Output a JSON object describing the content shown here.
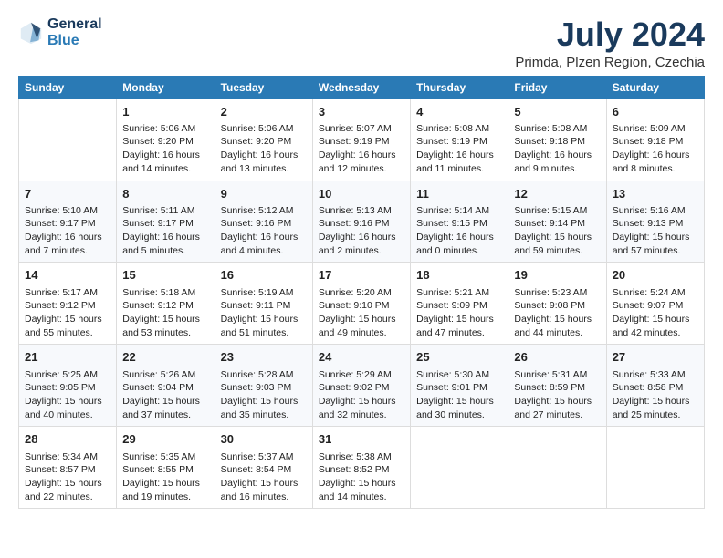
{
  "header": {
    "logo_line1": "General",
    "logo_line2": "Blue",
    "title": "July 2024",
    "subtitle": "Primda, Plzen Region, Czechia"
  },
  "columns": [
    "Sunday",
    "Monday",
    "Tuesday",
    "Wednesday",
    "Thursday",
    "Friday",
    "Saturday"
  ],
  "weeks": [
    {
      "cells": [
        {
          "day": "",
          "lines": []
        },
        {
          "day": "1",
          "lines": [
            "Sunrise: 5:06 AM",
            "Sunset: 9:20 PM",
            "Daylight: 16 hours",
            "and 14 minutes."
          ]
        },
        {
          "day": "2",
          "lines": [
            "Sunrise: 5:06 AM",
            "Sunset: 9:20 PM",
            "Daylight: 16 hours",
            "and 13 minutes."
          ]
        },
        {
          "day": "3",
          "lines": [
            "Sunrise: 5:07 AM",
            "Sunset: 9:19 PM",
            "Daylight: 16 hours",
            "and 12 minutes."
          ]
        },
        {
          "day": "4",
          "lines": [
            "Sunrise: 5:08 AM",
            "Sunset: 9:19 PM",
            "Daylight: 16 hours",
            "and 11 minutes."
          ]
        },
        {
          "day": "5",
          "lines": [
            "Sunrise: 5:08 AM",
            "Sunset: 9:18 PM",
            "Daylight: 16 hours",
            "and 9 minutes."
          ]
        },
        {
          "day": "6",
          "lines": [
            "Sunrise: 5:09 AM",
            "Sunset: 9:18 PM",
            "Daylight: 16 hours",
            "and 8 minutes."
          ]
        }
      ]
    },
    {
      "cells": [
        {
          "day": "7",
          "lines": [
            "Sunrise: 5:10 AM",
            "Sunset: 9:17 PM",
            "Daylight: 16 hours",
            "and 7 minutes."
          ]
        },
        {
          "day": "8",
          "lines": [
            "Sunrise: 5:11 AM",
            "Sunset: 9:17 PM",
            "Daylight: 16 hours",
            "and 5 minutes."
          ]
        },
        {
          "day": "9",
          "lines": [
            "Sunrise: 5:12 AM",
            "Sunset: 9:16 PM",
            "Daylight: 16 hours",
            "and 4 minutes."
          ]
        },
        {
          "day": "10",
          "lines": [
            "Sunrise: 5:13 AM",
            "Sunset: 9:16 PM",
            "Daylight: 16 hours",
            "and 2 minutes."
          ]
        },
        {
          "day": "11",
          "lines": [
            "Sunrise: 5:14 AM",
            "Sunset: 9:15 PM",
            "Daylight: 16 hours",
            "and 0 minutes."
          ]
        },
        {
          "day": "12",
          "lines": [
            "Sunrise: 5:15 AM",
            "Sunset: 9:14 PM",
            "Daylight: 15 hours",
            "and 59 minutes."
          ]
        },
        {
          "day": "13",
          "lines": [
            "Sunrise: 5:16 AM",
            "Sunset: 9:13 PM",
            "Daylight: 15 hours",
            "and 57 minutes."
          ]
        }
      ]
    },
    {
      "cells": [
        {
          "day": "14",
          "lines": [
            "Sunrise: 5:17 AM",
            "Sunset: 9:12 PM",
            "Daylight: 15 hours",
            "and 55 minutes."
          ]
        },
        {
          "day": "15",
          "lines": [
            "Sunrise: 5:18 AM",
            "Sunset: 9:12 PM",
            "Daylight: 15 hours",
            "and 53 minutes."
          ]
        },
        {
          "day": "16",
          "lines": [
            "Sunrise: 5:19 AM",
            "Sunset: 9:11 PM",
            "Daylight: 15 hours",
            "and 51 minutes."
          ]
        },
        {
          "day": "17",
          "lines": [
            "Sunrise: 5:20 AM",
            "Sunset: 9:10 PM",
            "Daylight: 15 hours",
            "and 49 minutes."
          ]
        },
        {
          "day": "18",
          "lines": [
            "Sunrise: 5:21 AM",
            "Sunset: 9:09 PM",
            "Daylight: 15 hours",
            "and 47 minutes."
          ]
        },
        {
          "day": "19",
          "lines": [
            "Sunrise: 5:23 AM",
            "Sunset: 9:08 PM",
            "Daylight: 15 hours",
            "and 44 minutes."
          ]
        },
        {
          "day": "20",
          "lines": [
            "Sunrise: 5:24 AM",
            "Sunset: 9:07 PM",
            "Daylight: 15 hours",
            "and 42 minutes."
          ]
        }
      ]
    },
    {
      "cells": [
        {
          "day": "21",
          "lines": [
            "Sunrise: 5:25 AM",
            "Sunset: 9:05 PM",
            "Daylight: 15 hours",
            "and 40 minutes."
          ]
        },
        {
          "day": "22",
          "lines": [
            "Sunrise: 5:26 AM",
            "Sunset: 9:04 PM",
            "Daylight: 15 hours",
            "and 37 minutes."
          ]
        },
        {
          "day": "23",
          "lines": [
            "Sunrise: 5:28 AM",
            "Sunset: 9:03 PM",
            "Daylight: 15 hours",
            "and 35 minutes."
          ]
        },
        {
          "day": "24",
          "lines": [
            "Sunrise: 5:29 AM",
            "Sunset: 9:02 PM",
            "Daylight: 15 hours",
            "and 32 minutes."
          ]
        },
        {
          "day": "25",
          "lines": [
            "Sunrise: 5:30 AM",
            "Sunset: 9:01 PM",
            "Daylight: 15 hours",
            "and 30 minutes."
          ]
        },
        {
          "day": "26",
          "lines": [
            "Sunrise: 5:31 AM",
            "Sunset: 8:59 PM",
            "Daylight: 15 hours",
            "and 27 minutes."
          ]
        },
        {
          "day": "27",
          "lines": [
            "Sunrise: 5:33 AM",
            "Sunset: 8:58 PM",
            "Daylight: 15 hours",
            "and 25 minutes."
          ]
        }
      ]
    },
    {
      "cells": [
        {
          "day": "28",
          "lines": [
            "Sunrise: 5:34 AM",
            "Sunset: 8:57 PM",
            "Daylight: 15 hours",
            "and 22 minutes."
          ]
        },
        {
          "day": "29",
          "lines": [
            "Sunrise: 5:35 AM",
            "Sunset: 8:55 PM",
            "Daylight: 15 hours",
            "and 19 minutes."
          ]
        },
        {
          "day": "30",
          "lines": [
            "Sunrise: 5:37 AM",
            "Sunset: 8:54 PM",
            "Daylight: 15 hours",
            "and 16 minutes."
          ]
        },
        {
          "day": "31",
          "lines": [
            "Sunrise: 5:38 AM",
            "Sunset: 8:52 PM",
            "Daylight: 15 hours",
            "and 14 minutes."
          ]
        },
        {
          "day": "",
          "lines": []
        },
        {
          "day": "",
          "lines": []
        },
        {
          "day": "",
          "lines": []
        }
      ]
    }
  ]
}
